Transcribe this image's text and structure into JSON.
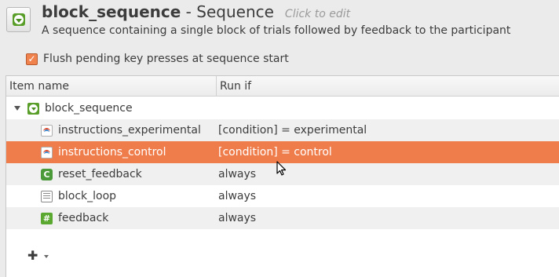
{
  "header": {
    "item_name": "block_sequence",
    "separator": " - ",
    "item_type": "Sequence",
    "click_to_edit": "Click to edit",
    "description": "A sequence containing a single block of trials followed by feedback to the participant",
    "icon": "sequence-icon"
  },
  "options": {
    "flush_label": "Flush pending key presses at sequence start",
    "flush_checked": true
  },
  "tree": {
    "columns": [
      "Item name",
      "Run if"
    ],
    "rows": [
      {
        "name": "block_sequence",
        "run_if": "",
        "icon": "sequence-icon",
        "expanded": true
      },
      {
        "name": "instructions_experimental",
        "run_if": "[condition] = experimental",
        "icon": "sketchpad-icon"
      },
      {
        "name": "instructions_control",
        "run_if": "[condition] = control",
        "icon": "sketchpad-icon",
        "selected": true
      },
      {
        "name": "reset_feedback",
        "run_if": "always",
        "icon": "reset-feedback-icon"
      },
      {
        "name": "block_loop",
        "run_if": "always",
        "icon": "loop-icon"
      },
      {
        "name": "feedback",
        "run_if": "always",
        "icon": "feedback-icon"
      }
    ]
  },
  "toolbar": {
    "add_symbol": "✚",
    "reset_glyph": "C",
    "feedback_glyph": "#"
  },
  "colors": {
    "selection": "#ef7d4c",
    "checkbox": "#f0824e",
    "sequence_green": "#5a9e2a"
  }
}
